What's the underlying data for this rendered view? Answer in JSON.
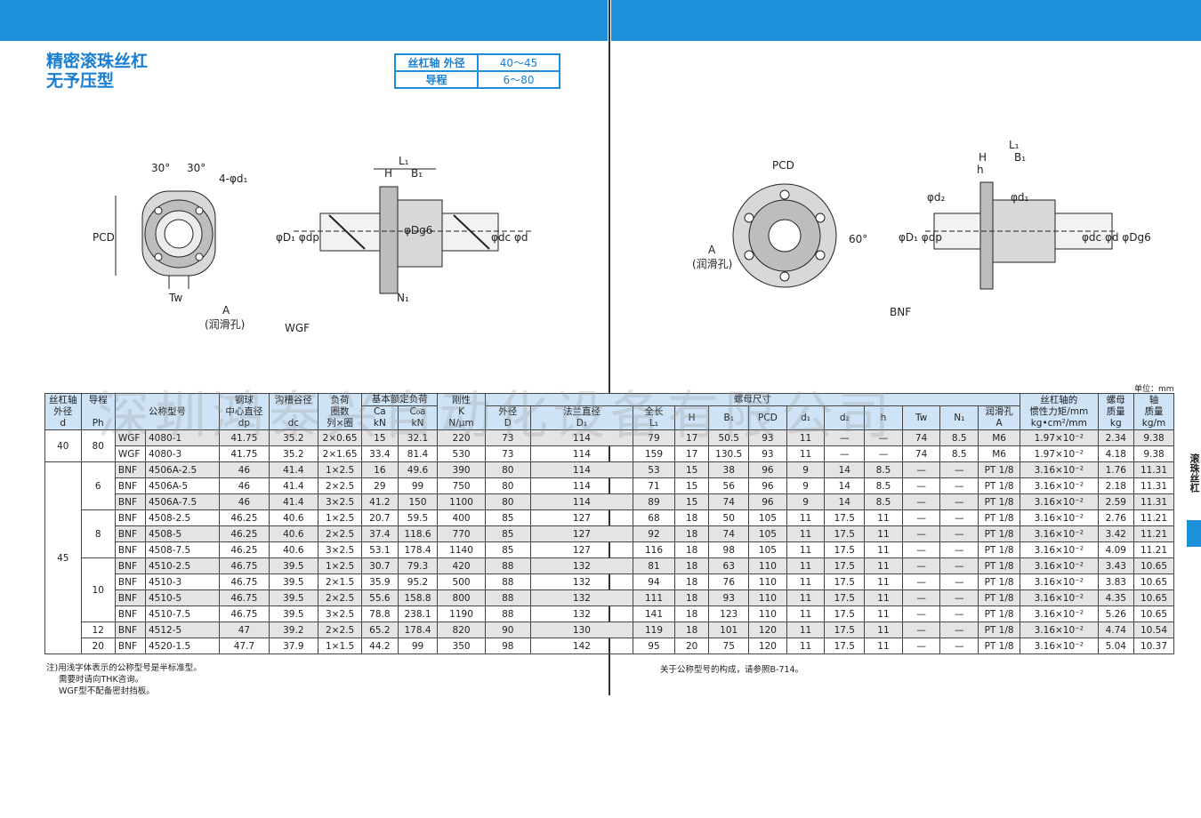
{
  "header": {
    "title_line1": "精密滚珠丝杠",
    "title_line2": "无予压型"
  },
  "spec": {
    "k1": "丝杠轴 外径",
    "v1": "40～45",
    "k2": "导程",
    "v2": "6～80"
  },
  "drawings": {
    "left_label": "WGF",
    "right_label": "BNF",
    "pcd": "PCD",
    "a": "A",
    "lube": "(润滑孔)",
    "tw": "Tw",
    "angle30a": "30°",
    "angle30b": "30°",
    "hole": "4-φd₁",
    "l1": "L₁",
    "h": "H",
    "b1": "B₁",
    "n1": "N₁",
    "d1dp": "φD₁ φdp",
    "dg6": "φDg6",
    "dcd": "φdc φd",
    "angle60": "60°",
    "d2": "φd₂",
    "d1small": "φd₁",
    "hh": "h",
    "right_dcd": "φdc φd φDg6"
  },
  "unit": "单位：mm",
  "table": {
    "head": {
      "c1": "丝杠轴\n外径\nd",
      "c2": "导程\n\nPh",
      "c3": "公称型号",
      "c4": "钢球\n中心直径\ndp",
      "c5": "沟槽谷径\n\ndc",
      "c6": "负荷\n圈数\n列×圈",
      "c7": "基本额定负荷",
      "c7a": "Ca\nkN",
      "c7b": "C₀a\nkN",
      "c8": "刚性\nK\nN/μm",
      "c9": "螺母尺寸",
      "c9a": "外径\nD",
      "c9b": "法兰直径\nD₁",
      "c9c": "全长\nL₁",
      "c9d": "H",
      "c9e": "B₁",
      "c9f": "PCD",
      "c9g": "d₁",
      "c9h": "d₂",
      "c9i": "h",
      "c9j": "Tw",
      "c9k": "N₁",
      "c9l": "润滑孔\nA",
      "c10": "丝杠轴的\n惯性力矩/mm\nkg•cm²/mm",
      "c11": "螺母\n质量\nkg",
      "c12": "轴\n质量\nkg/m"
    },
    "rows": [
      [
        "40",
        "80",
        "WGF",
        "4080-1",
        "41.75",
        "35.2",
        "2×0.65",
        "15",
        "32.1",
        "220",
        "73",
        "114",
        "79",
        "17",
        "50.5",
        "93",
        "11",
        "—",
        "—",
        "74",
        "8.5",
        "M6",
        "1.97×10⁻²",
        "2.34",
        "9.38"
      ],
      [
        "",
        "",
        "WGF",
        "4080-3",
        "41.75",
        "35.2",
        "2×1.65",
        "33.4",
        "81.4",
        "530",
        "73",
        "114",
        "159",
        "17",
        "130.5",
        "93",
        "11",
        "—",
        "—",
        "74",
        "8.5",
        "M6",
        "1.97×10⁻²",
        "4.18",
        "9.38"
      ],
      [
        "45",
        "6",
        "BNF",
        "4506A-2.5",
        "46",
        "41.4",
        "1×2.5",
        "16",
        "49.6",
        "390",
        "80",
        "114",
        "53",
        "15",
        "38",
        "96",
        "9",
        "14",
        "8.5",
        "—",
        "—",
        "PT 1/8",
        "3.16×10⁻²",
        "1.76",
        "11.31"
      ],
      [
        "",
        "",
        "BNF",
        "4506A-5",
        "46",
        "41.4",
        "2×2.5",
        "29",
        "99",
        "750",
        "80",
        "114",
        "71",
        "15",
        "56",
        "96",
        "9",
        "14",
        "8.5",
        "—",
        "—",
        "PT 1/8",
        "3.16×10⁻²",
        "2.18",
        "11.31"
      ],
      [
        "",
        "",
        "BNF",
        "4506A-7.5",
        "46",
        "41.4",
        "3×2.5",
        "41.2",
        "150",
        "1100",
        "80",
        "114",
        "89",
        "15",
        "74",
        "96",
        "9",
        "14",
        "8.5",
        "—",
        "—",
        "PT 1/8",
        "3.16×10⁻²",
        "2.59",
        "11.31"
      ],
      [
        "",
        "8",
        "BNF",
        "4508-2.5",
        "46.25",
        "40.6",
        "1×2.5",
        "20.7",
        "59.5",
        "400",
        "85",
        "127",
        "68",
        "18",
        "50",
        "105",
        "11",
        "17.5",
        "11",
        "—",
        "—",
        "PT 1/8",
        "3.16×10⁻²",
        "2.76",
        "11.21"
      ],
      [
        "",
        "",
        "BNF",
        "4508-5",
        "46.25",
        "40.6",
        "2×2.5",
        "37.4",
        "118.6",
        "770",
        "85",
        "127",
        "92",
        "18",
        "74",
        "105",
        "11",
        "17.5",
        "11",
        "—",
        "—",
        "PT 1/8",
        "3.16×10⁻²",
        "3.42",
        "11.21"
      ],
      [
        "",
        "",
        "BNF",
        "4508-7.5",
        "46.25",
        "40.6",
        "3×2.5",
        "53.1",
        "178.4",
        "1140",
        "85",
        "127",
        "116",
        "18",
        "98",
        "105",
        "11",
        "17.5",
        "11",
        "—",
        "—",
        "PT 1/8",
        "3.16×10⁻²",
        "4.09",
        "11.21"
      ],
      [
        "",
        "10",
        "BNF",
        "4510-2.5",
        "46.75",
        "39.5",
        "1×2.5",
        "30.7",
        "79.3",
        "420",
        "88",
        "132",
        "81",
        "18",
        "63",
        "110",
        "11",
        "17.5",
        "11",
        "—",
        "—",
        "PT 1/8",
        "3.16×10⁻²",
        "3.43",
        "10.65"
      ],
      [
        "",
        "",
        "BNF",
        "4510-3",
        "46.75",
        "39.5",
        "2×1.5",
        "35.9",
        "95.2",
        "500",
        "88",
        "132",
        "94",
        "18",
        "76",
        "110",
        "11",
        "17.5",
        "11",
        "—",
        "—",
        "PT 1/8",
        "3.16×10⁻²",
        "3.83",
        "10.65"
      ],
      [
        "",
        "",
        "BNF",
        "4510-5",
        "46.75",
        "39.5",
        "2×2.5",
        "55.6",
        "158.8",
        "800",
        "88",
        "132",
        "111",
        "18",
        "93",
        "110",
        "11",
        "17.5",
        "11",
        "—",
        "—",
        "PT 1/8",
        "3.16×10⁻²",
        "4.35",
        "10.65"
      ],
      [
        "",
        "",
        "BNF",
        "4510-7.5",
        "46.75",
        "39.5",
        "3×2.5",
        "78.8",
        "238.1",
        "1190",
        "88",
        "132",
        "141",
        "18",
        "123",
        "110",
        "11",
        "17.5",
        "11",
        "—",
        "—",
        "PT 1/8",
        "3.16×10⁻²",
        "5.26",
        "10.65"
      ],
      [
        "",
        "12",
        "BNF",
        "4512-5",
        "47",
        "39.2",
        "2×2.5",
        "65.2",
        "178.4",
        "820",
        "90",
        "130",
        "119",
        "18",
        "101",
        "120",
        "11",
        "17.5",
        "11",
        "—",
        "—",
        "PT 1/8",
        "3.16×10⁻²",
        "4.74",
        "10.54"
      ],
      [
        "",
        "20",
        "BNF",
        "4520-1.5",
        "47.7",
        "37.9",
        "1×1.5",
        "44.2",
        "99",
        "350",
        "98",
        "142",
        "95",
        "20",
        "75",
        "120",
        "11",
        "17.5",
        "11",
        "—",
        "—",
        "PT 1/8",
        "3.16×10⁻²",
        "5.04",
        "10.37"
      ]
    ]
  },
  "notes": {
    "n1": "注)用浅字体表示的公称型号是半标准型。",
    "n2": "需要时请向THK咨询。",
    "n3": "WGF型不配备密封挡板。",
    "ref": "关于公称型号的构成，请参照B-714。"
  },
  "side": {
    "tab": "滚珠丝杠"
  },
  "watermark": "深圳鸿泰兴自动化设备有限公司"
}
